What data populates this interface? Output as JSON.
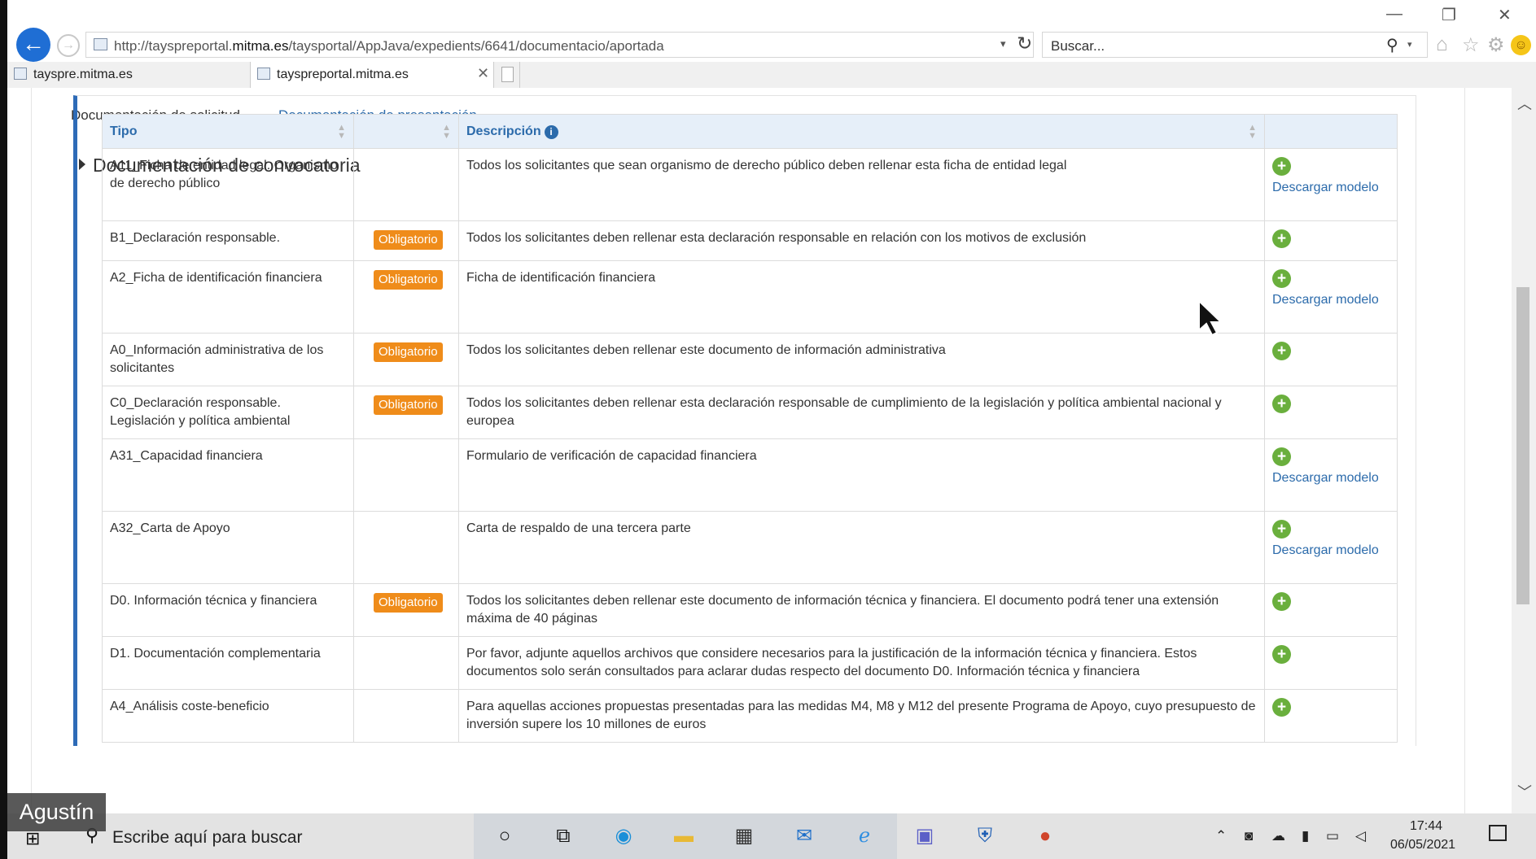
{
  "browser": {
    "url_prefix": "http://tayspreportal.",
    "url_domain": "mitma.es",
    "url_path": "/taysportal/AppJava/expedients/6641/documentacio/aportada",
    "search_placeholder": "Buscar...",
    "tabs": [
      {
        "label": "tayspre.mitma.es"
      },
      {
        "label": "tayspreportal.mitma.es"
      }
    ],
    "icons": [
      "back-icon",
      "forward-icon",
      "refresh-icon",
      "search-icon",
      "home-icon",
      "star-icon",
      "gear-icon",
      "smiley-icon"
    ]
  },
  "page": {
    "subtabs": [
      "Documentación de solicitud",
      "Documentación de presentación"
    ],
    "section_title": "Documentación de convocatoria",
    "table": {
      "headers": {
        "tipo": "Tipo",
        "col2": "",
        "descripcion": "Descripción",
        "col4": ""
      },
      "badge_label": "Obligatorio",
      "download_label": "Descargar modelo",
      "rows": [
        {
          "tipo": "A11_Ficha de entidad legal. Organismo de derecho público",
          "obligatorio": false,
          "descripcion": "Todos los solicitantes que sean organismo de derecho público deben rellenar esta ficha de entidad legal",
          "descargar": true
        },
        {
          "tipo": "B1_Declaración responsable.",
          "obligatorio": true,
          "descripcion": "Todos los solicitantes deben rellenar esta declaración responsable en relación con los motivos de exclusión",
          "descargar": false
        },
        {
          "tipo": "A2_Ficha de identificación financiera",
          "obligatorio": true,
          "descripcion": "Ficha de identificación financiera",
          "descargar": true
        },
        {
          "tipo": "A0_Información administrativa de los solicitantes",
          "obligatorio": true,
          "descripcion": "Todos los solicitantes deben rellenar este documento de información administrativa",
          "descargar": false
        },
        {
          "tipo": "C0_Declaración responsable. Legislación y política ambiental",
          "obligatorio": true,
          "descripcion": "Todos los solicitantes deben rellenar esta declaración responsable de cumplimiento de la legislación y política ambiental nacional y europea",
          "descargar": false
        },
        {
          "tipo": "A31_Capacidad financiera",
          "obligatorio": false,
          "descripcion": "Formulario de verificación de capacidad financiera",
          "descargar": true
        },
        {
          "tipo": "A32_Carta de Apoyo",
          "obligatorio": false,
          "descripcion": "Carta de respaldo de una tercera parte",
          "descargar": true
        },
        {
          "tipo": "D0. Información técnica y financiera",
          "obligatorio": true,
          "descripcion": "Todos los solicitantes deben rellenar este documento de información técnica y financiera. El documento podrá tener una extensión máxima de 40 páginas",
          "descargar": false
        },
        {
          "tipo": "D1. Documentación complementaria",
          "obligatorio": false,
          "descripcion": "Por favor, adjunte aquellos archivos que considere necesarios para la justificación de la información técnica y financiera. Estos documentos solo serán consultados para aclarar dudas respecto del documento D0. Información técnica y financiera",
          "descargar": false
        },
        {
          "tipo": "A4_Análisis coste-beneficio",
          "obligatorio": false,
          "descripcion": "Para aquellas acciones propuestas presentadas para las medidas M4, M8 y M12 del presente Programa de Apoyo, cuyo presupuesto de inversión supere los 10 millones de euros",
          "descargar": false
        }
      ]
    }
  },
  "taskbar": {
    "search_text": "Escribe aquí para buscar",
    "time": "17:44",
    "date": "06/05/2021",
    "apps": [
      "cortana-icon",
      "task-view-icon",
      "edge-icon",
      "file-explorer-icon",
      "store-icon",
      "mail-icon",
      "internet-explorer-icon",
      "teams-icon",
      "defender-icon",
      "powerpoint-icon"
    ]
  },
  "overlay": {
    "presenter_name": "Agustín"
  },
  "colors": {
    "link": "#2c6bab",
    "badge": "#ef8c1a",
    "add": "#6aaf3d",
    "section_accent": "#2e6bb7",
    "header_bg": "#e6eff9"
  }
}
